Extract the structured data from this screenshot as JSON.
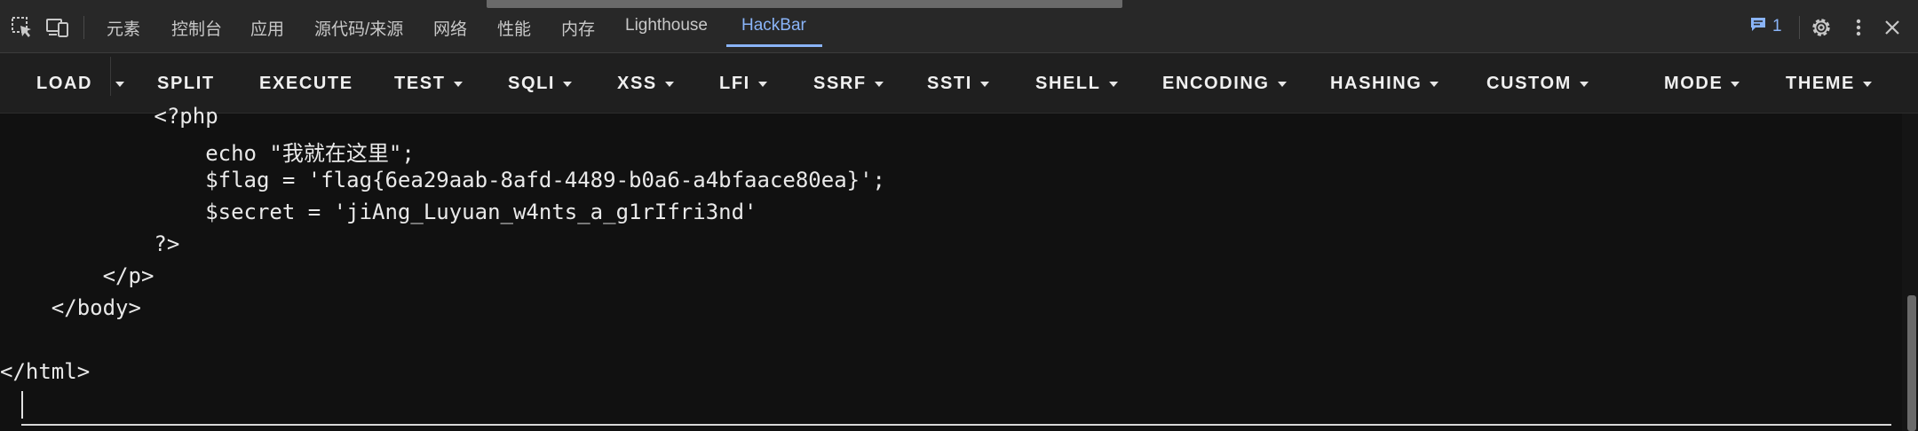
{
  "topbar": {
    "tabs": [
      {
        "label": "元素",
        "active": false
      },
      {
        "label": "控制台",
        "active": false
      },
      {
        "label": "应用",
        "active": false
      },
      {
        "label": "源代码/来源",
        "active": false
      },
      {
        "label": "网络",
        "active": false
      },
      {
        "label": "性能",
        "active": false
      },
      {
        "label": "内存",
        "active": false
      },
      {
        "label": "Lighthouse",
        "active": false
      },
      {
        "label": "HackBar",
        "active": true
      }
    ],
    "issues_count": "1",
    "icons": [
      "inspect-element-icon",
      "device-toolbar-icon",
      "message-icon",
      "settings-icon",
      "more-options-icon",
      "close-icon"
    ]
  },
  "hackbar": {
    "buttons": [
      {
        "label": "LOAD",
        "dropdown": false
      },
      {
        "label": "SPLIT",
        "dropdown": false
      },
      {
        "label": "EXECUTE",
        "dropdown": false
      },
      {
        "label": "TEST",
        "dropdown": true
      },
      {
        "label": "SQLI",
        "dropdown": true
      },
      {
        "label": "XSS",
        "dropdown": true
      },
      {
        "label": "LFI",
        "dropdown": true
      },
      {
        "label": "SSRF",
        "dropdown": true
      },
      {
        "label": "SSTI",
        "dropdown": true
      },
      {
        "label": "SHELL",
        "dropdown": true
      },
      {
        "label": "ENCODING",
        "dropdown": true
      },
      {
        "label": "HASHING",
        "dropdown": true
      },
      {
        "label": "CUSTOM",
        "dropdown": true
      },
      {
        "label": "MODE",
        "dropdown": true
      },
      {
        "label": "THEME",
        "dropdown": true
      }
    ]
  },
  "editor": {
    "lines": [
      "            <?php",
      "                echo \"我就在这里\";",
      "                $flag = 'flag{6ea29aab-8afd-4489-b0a6-a4bfaace80ea}';",
      "                $secret = 'jiAng_Luyuan_w4nts_a_g1rIfri3nd'",
      "            ?>",
      "        </p>",
      "    </body>",
      "",
      "</html>"
    ]
  },
  "colors": {
    "background": "#111111",
    "topbar": "#282828",
    "toolbar": "#1f1f1f",
    "accent": "#8ab4f8",
    "text": "#e9e9e9"
  }
}
